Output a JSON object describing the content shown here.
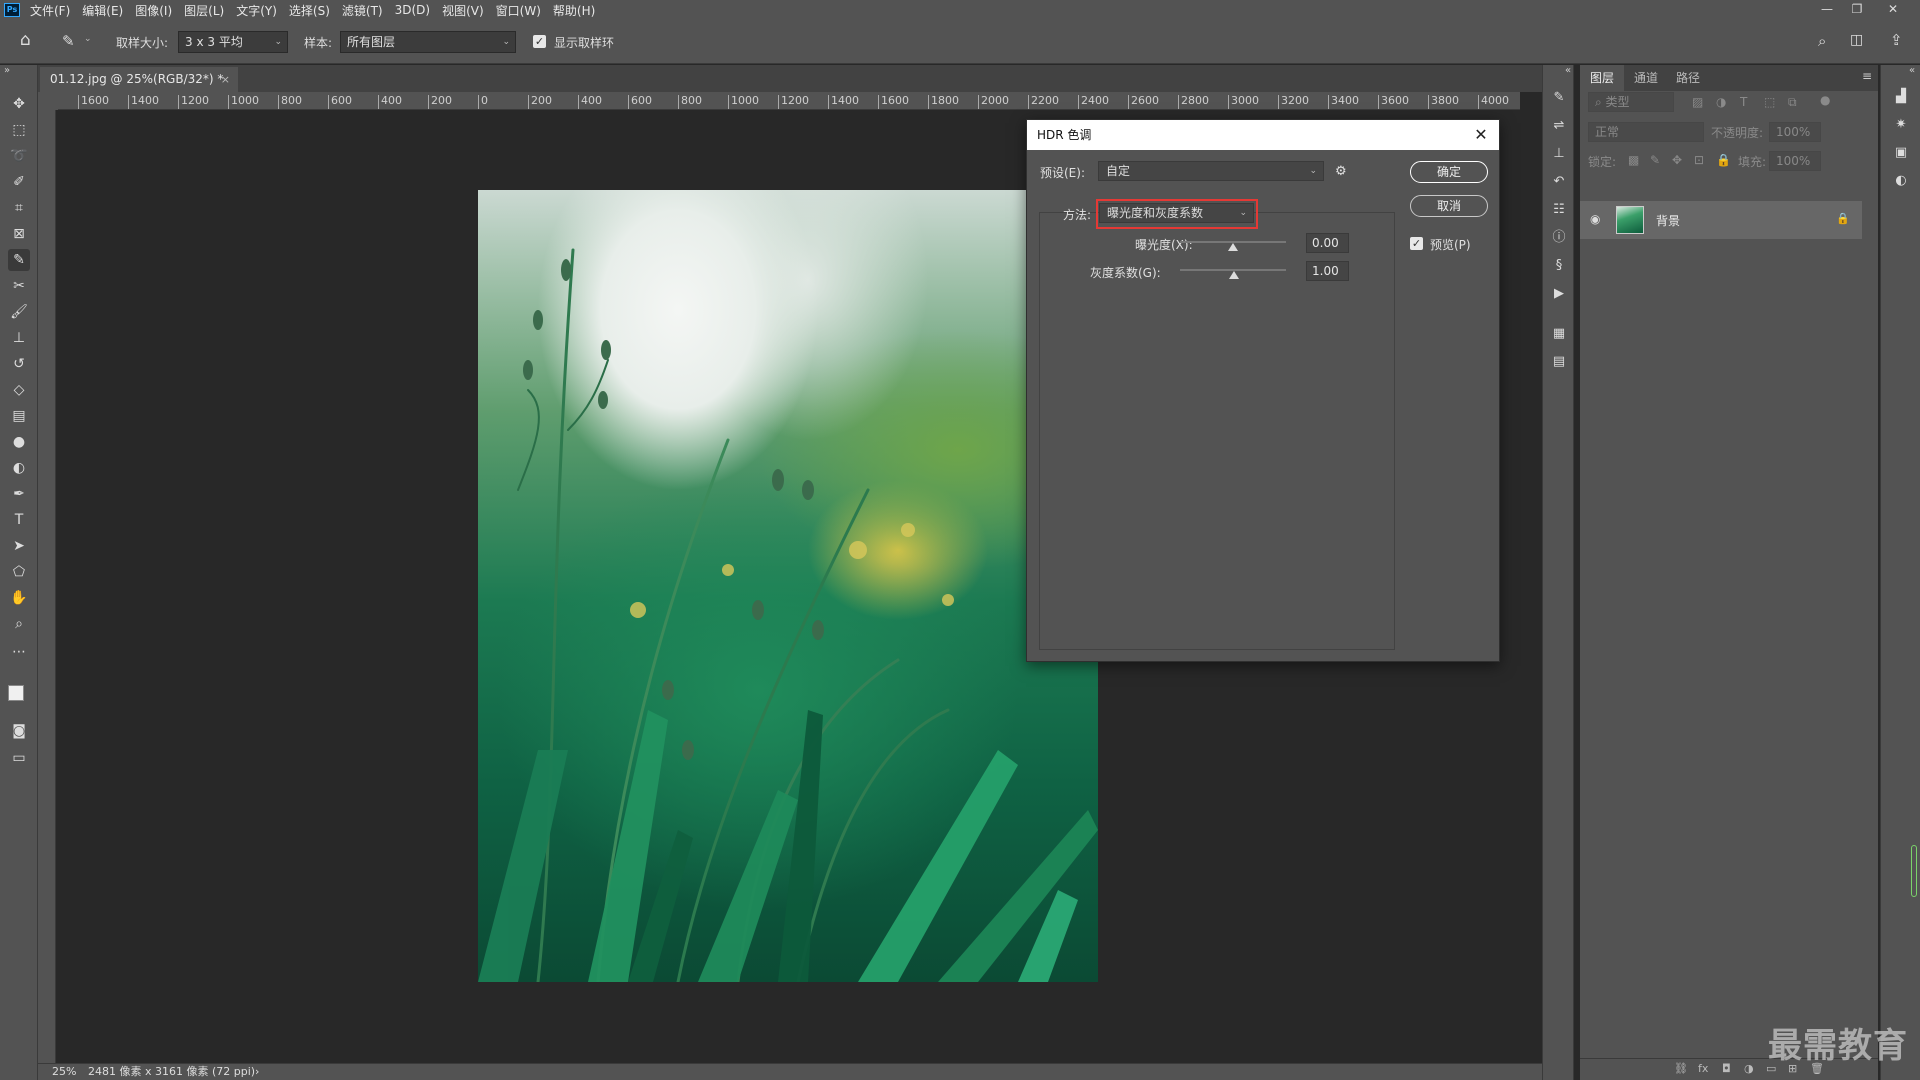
{
  "app": {
    "menu": [
      "文件(F)",
      "编辑(E)",
      "图像(I)",
      "图层(L)",
      "文字(Y)",
      "选择(S)",
      "滤镜(T)",
      "3D(D)",
      "视图(V)",
      "窗口(W)",
      "帮助(H)"
    ],
    "logo": "Ps"
  },
  "options": {
    "sample_size_label": "取样大小:",
    "sample_size_value": "3 x 3 平均",
    "sample_label": "样本:",
    "sample_value": "所有图层",
    "show_ring_label": "显示取样环",
    "show_ring_checked": true
  },
  "document": {
    "tab_title": "01.12.jpg @ 25%(RGB/32*) *",
    "tab_close": "×",
    "ruler_ticks": [
      "1600",
      "1400",
      "1200",
      "1000",
      "800",
      "600",
      "400",
      "200",
      "0",
      "200",
      "400",
      "600",
      "800",
      "1000",
      "1200",
      "1400",
      "1600",
      "1800",
      "2000",
      "2200",
      "2400",
      "2600",
      "2800",
      "3000",
      "3200",
      "3400",
      "3600",
      "3800",
      "4000"
    ]
  },
  "status": {
    "zoom": "25%",
    "info": "2481 像素 x 3161 像素 (72 ppi)",
    "arrow": "›"
  },
  "layers_panel": {
    "tabs": [
      "图层",
      "通道",
      "路径"
    ],
    "filter_placeholder": "类型",
    "blend_mode": "正常",
    "opacity_label": "不透明度:",
    "opacity_value": "100%",
    "lock_label": "锁定:",
    "fill_label": "填充:",
    "fill_value": "100%",
    "layer_name": "背景"
  },
  "dialog": {
    "title": "HDR 色调",
    "close": "✕",
    "preset_label": "预设(E):",
    "preset_value": "自定",
    "method_label": "方法:",
    "method_value": "曝光度和灰度系数",
    "exposure_label": "曝光度(X):",
    "exposure_value": "0.00",
    "gamma_label": "灰度系数(G):",
    "gamma_value": "1.00",
    "ok_label": "确定",
    "cancel_label": "取消",
    "preview_label": "预览(P)",
    "preview_checked": true
  },
  "watermark": "最需教育",
  "colors": {
    "panel": "#535353",
    "canvas": "#282828",
    "highlight": "#e53935"
  }
}
